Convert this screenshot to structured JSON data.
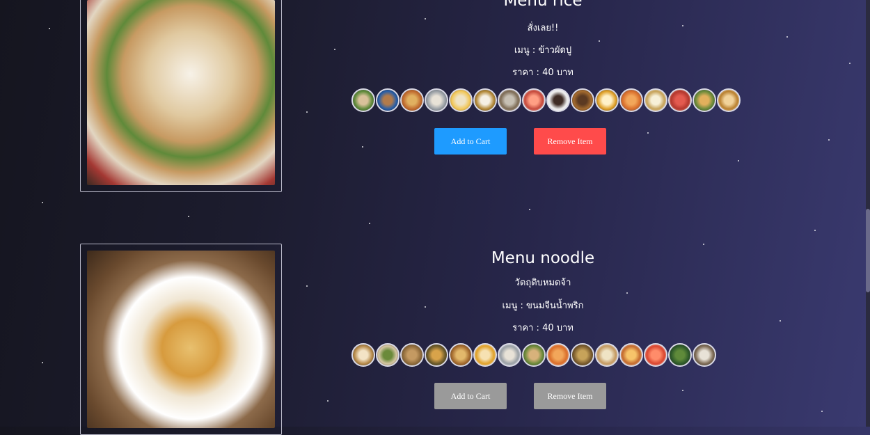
{
  "menus": [
    {
      "title": "Menu rice",
      "status": "สั่งเลย!!",
      "menu_line": "เมนู : ข้าวผัดปู",
      "price_line": "ราคา : 40 บาท",
      "add_label": "Add to Cart",
      "remove_label": "Remove Item",
      "buttons_state": "enabled"
    },
    {
      "title": "Menu noodle",
      "status": "วัตถุดิบหมดจ้า",
      "menu_line": "เมนู : ขนมจีนน้ำพริก",
      "price_line": "ราคา : 40 บาท",
      "add_label": "Add to Cart",
      "remove_label": "Remove Item",
      "buttons_state": "disabled"
    }
  ],
  "colors": {
    "add_button": "#1e9bff",
    "remove_button": "#ff4b4b",
    "disabled_button": "#9a9a9a"
  }
}
